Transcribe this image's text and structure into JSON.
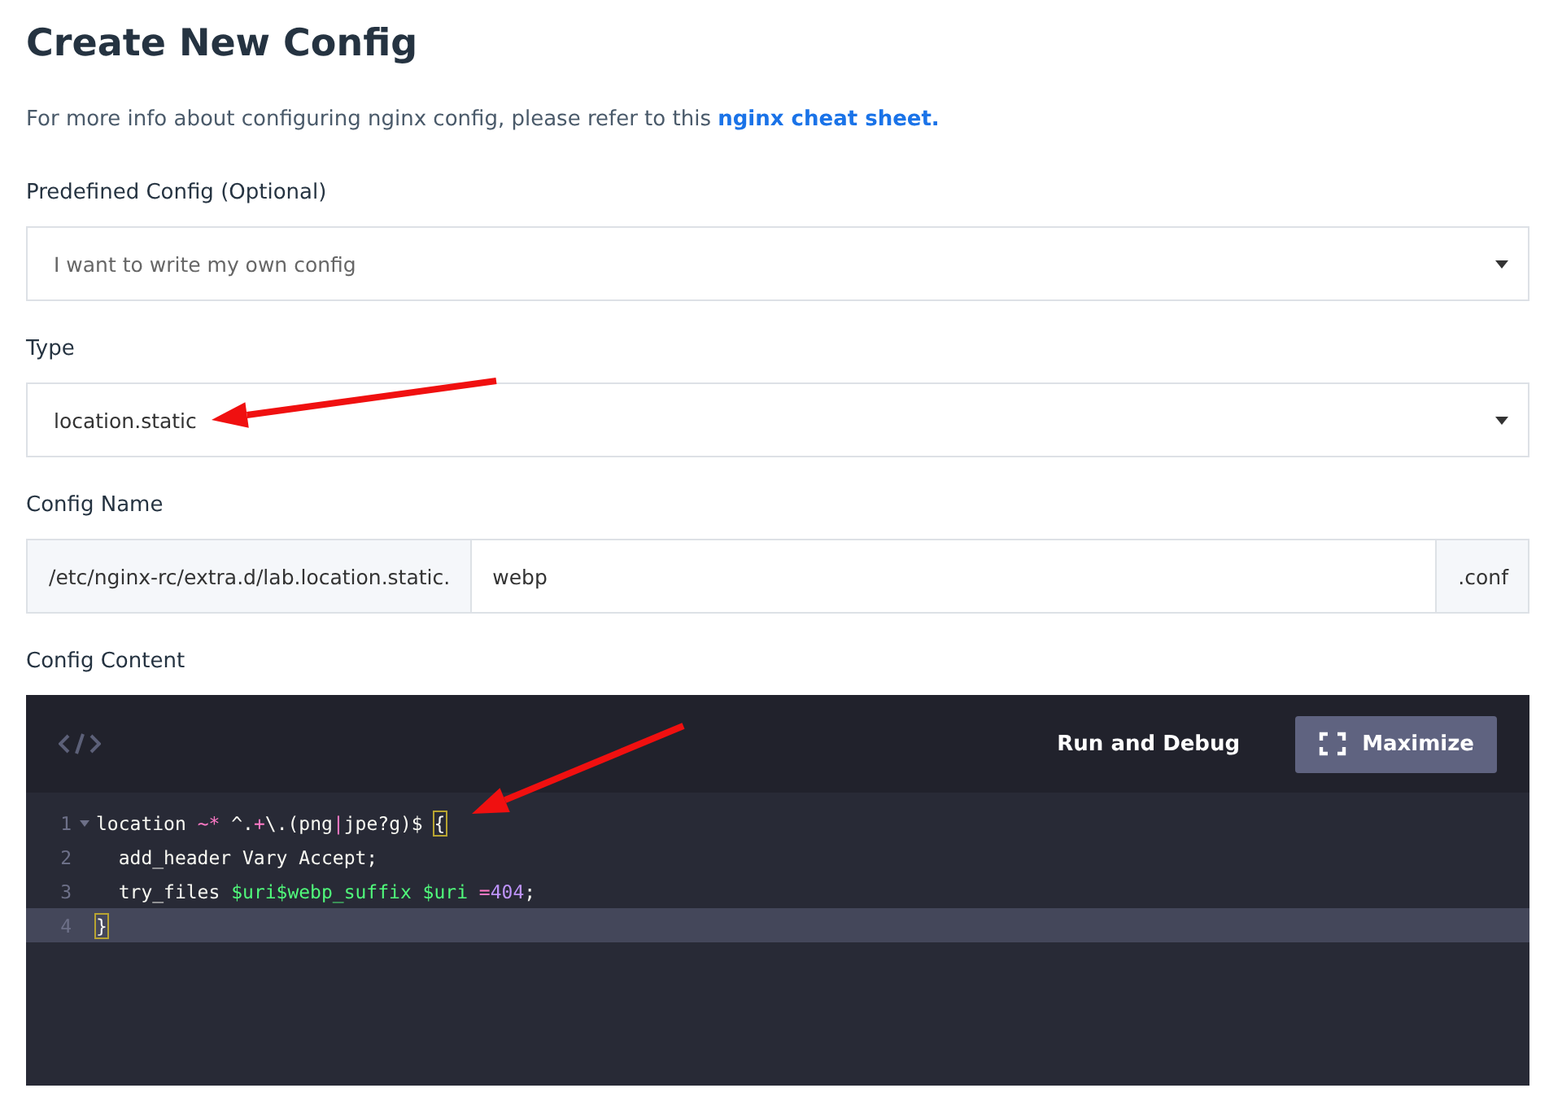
{
  "title": "Create New Config",
  "intro": {
    "text": "For more info about configuring nginx config, please refer to this ",
    "link": "nginx cheat sheet."
  },
  "fields": [
    {
      "label": "Predefined Config (Optional)",
      "kind": "select",
      "value": "I want to write my own config",
      "placeholder_style": true,
      "arrow_pointed": false
    },
    {
      "label": "Type",
      "kind": "select",
      "value": "location.static",
      "placeholder_style": false,
      "arrow_pointed": true
    },
    {
      "label": "Config Name",
      "kind": "name",
      "prefix": "/etc/nginx-rc/extra.d/lab.location.static.",
      "value": "webp",
      "suffix": ".conf",
      "arrow_pointed": false
    }
  ],
  "editor": {
    "label": "Config Content",
    "arrow_pointed": true,
    "run_button": "Run and Debug",
    "maximize_button": "Maximize",
    "lines": [
      {
        "number": "1",
        "foldable": true,
        "active": false,
        "tokens": [
          {
            "kind": "plain",
            "text": "location "
          },
          {
            "kind": "operator",
            "text": "~*"
          },
          {
            "kind": "plain",
            "text": " ^."
          },
          {
            "kind": "operator",
            "text": "+"
          },
          {
            "kind": "plain",
            "text": "\\.(png"
          },
          {
            "kind": "operator",
            "text": "|"
          },
          {
            "kind": "plain",
            "text": "jpe?g)$ "
          },
          {
            "kind": "bracket",
            "text": "{"
          }
        ]
      },
      {
        "number": "2",
        "foldable": false,
        "active": false,
        "tokens": [
          {
            "kind": "plain",
            "text": "  add_header Vary Accept;"
          }
        ]
      },
      {
        "number": "3",
        "foldable": false,
        "active": false,
        "tokens": [
          {
            "kind": "plain",
            "text": "  try_files "
          },
          {
            "kind": "variable",
            "text": "$uri$webp_suffix"
          },
          {
            "kind": "variable",
            "text": " $uri"
          },
          {
            "kind": "operator",
            "text": " ="
          },
          {
            "kind": "number",
            "text": "404"
          },
          {
            "kind": "plain",
            "text": ";"
          }
        ]
      },
      {
        "number": "4",
        "foldable": false,
        "active": true,
        "tokens": [
          {
            "kind": "bracket",
            "text": "}"
          }
        ]
      }
    ]
  }
}
